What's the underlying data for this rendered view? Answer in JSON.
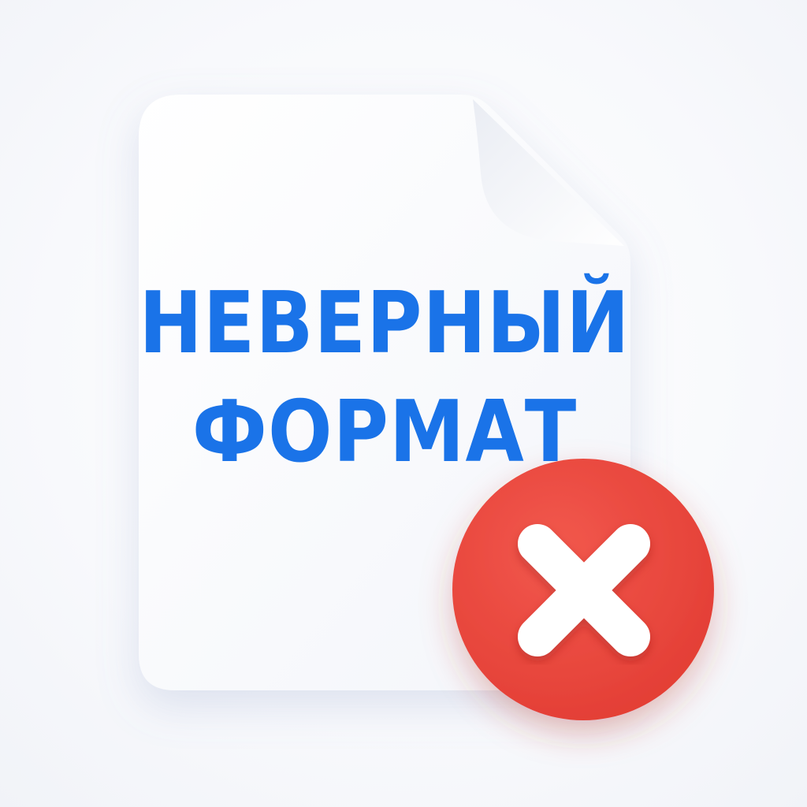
{
  "document": {
    "line1": "НЕВЕРНЫЙ",
    "line2": "ФОРМАТ"
  },
  "colors": {
    "text": "#1a73e8",
    "badge": "#e8433a",
    "paper": "#ffffff"
  },
  "icons": {
    "document": "document-icon",
    "error": "close-icon"
  }
}
